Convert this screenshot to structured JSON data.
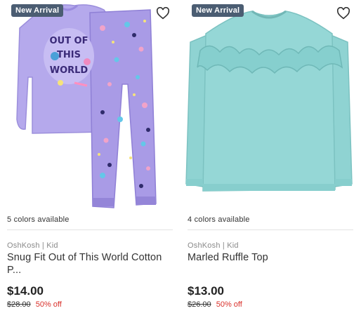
{
  "products": [
    {
      "badge": "New Arrival",
      "colors_available": "5 colors available",
      "brand_line": "OshKosh | Kid",
      "name": "Snug Fit Out of This World Cotton P...",
      "price": "$14.00",
      "original_price": "$28.00",
      "discount": "50% off",
      "shirt_print": [
        "OUT OF",
        "THIS",
        "WORLD"
      ],
      "icons": [
        "heart-icon"
      ]
    },
    {
      "badge": "New Arrival",
      "colors_available": "4 colors available",
      "brand_line": "OshKosh | Kid",
      "name": "Marled Ruffle Top",
      "price": "$13.00",
      "original_price": "$26.00",
      "discount": "50% off",
      "icons": [
        "heart-icon"
      ]
    }
  ],
  "colors": {
    "badge_bg": "#4b5d72",
    "discount_red": "#d9302a",
    "pajama_lavender": "#a99be6",
    "ruffle_top_teal": "#8fd3d2"
  }
}
